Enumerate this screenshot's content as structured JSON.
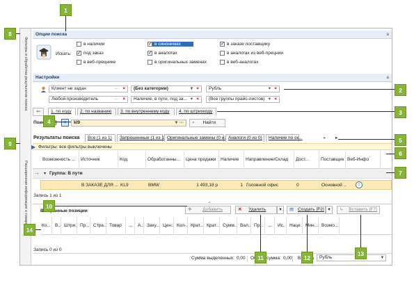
{
  "callouts": [
    "1",
    "2",
    "3",
    "4",
    "5",
    "6",
    "7",
    "8",
    "9",
    "10",
    "11",
    "12",
    "13",
    "14"
  ],
  "sidebar": {
    "top_label": "Фильтры и обработка результатов поиска",
    "bottom_label": "Расширенная информация о товаре"
  },
  "search_options": {
    "title": "Опции поиска",
    "pin": "a",
    "search_in_label": "Искать:",
    "options": [
      {
        "label": "в наличии",
        "checked": false
      },
      {
        "label": "под заказ",
        "checked": true
      },
      {
        "label": "в веб-прецнике",
        "checked": false
      },
      {
        "label": "в синонимах",
        "checked": true
      },
      {
        "label": "в аналогах",
        "checked": true
      },
      {
        "label": "в оригинальных заменах",
        "checked": false
      },
      {
        "label": "в заказе поставщику",
        "checked": true
      },
      {
        "label": "в аналогах из веб-прецнии",
        "checked": false
      },
      {
        "label": "в веб-аналогах",
        "checked": false
      }
    ]
  },
  "settings": {
    "title": "Настройки",
    "pin": "a",
    "client": "Клиент не задан",
    "manufacturer": "Любой производитель",
    "category": "(Без категории)",
    "availability": "Наличие, в пути, под за...",
    "currency": "Рубль",
    "price_groups": "(Все группы прайс-листов)"
  },
  "search_tabs": [
    {
      "label": "1. по коду"
    },
    {
      "label": "2. по названию"
    },
    {
      "label": "3. по внутреннему коду"
    },
    {
      "label": "4. по штрихкоду"
    }
  ],
  "search": {
    "label": "Поиск [F3]",
    "value": "kl9",
    "find_button": "Найти"
  },
  "results": {
    "title": "Результаты поиска",
    "tabs": [
      {
        "label": "Все (1 из 1)"
      },
      {
        "label": "Запрошенные (1 из 1)"
      },
      {
        "label": "Оригинальные замены (0 из 0)"
      },
      {
        "label": "Аналоги (0 из 0)"
      },
      {
        "label": "Наличие по ск..."
      }
    ],
    "filter_text": "Фильтры: все фильтры выключены",
    "columns": [
      "Возможность ...",
      "Источник",
      "Код",
      "Обработанны...",
      "Цена продажи",
      "Наличие",
      "Направление/Склад",
      "Дост...",
      "Поставщик",
      "Веб-Инфо"
    ],
    "group_label": "Группа: В пути",
    "row": [
      "",
      "В ЗАКАЗЕ ДЛЯ ...",
      "KL9",
      "BMW",
      "1 493,18 р",
      "1",
      "Головной офис",
      "0",
      "Основной ...",
      ""
    ],
    "record_count": "Запись 1 из 1"
  },
  "selected": {
    "title": "Выбранные позиции",
    "add_button": "Добавить",
    "delete_button": "Удалить",
    "create_button": "Создать [F2]",
    "insert_button": "Вставить [F7]",
    "columns": [
      "Ко...",
      "В...",
      "Штри...",
      "Пр...",
      "Стра...",
      "Товар",
      "...",
      "А...",
      "Заку...",
      "Цен...",
      "Кол-...",
      "Крат...",
      "Крат...",
      "Сумм...",
      "Вал...",
      "Пр...",
      "...",
      "Ис...",
      "Наце...",
      "Мин...",
      "Возмо..."
    ],
    "record_count": "Запись 0 из 0"
  },
  "footer": {
    "sum_selected_label": "Сумма выделенных:",
    "sum_selected_value": "0,00",
    "total_sum_label": "Общая сумма:",
    "total_sum_value": "0,00",
    "currency_label": "Валюта",
    "currency_value": "Рубль"
  },
  "colors": {
    "callout": "#86b535",
    "panel_header": "#e8eef7",
    "group_row": "#f0f0f0",
    "selected_row": "#fbe9b8",
    "filter_bar": "#fdf6d8"
  }
}
